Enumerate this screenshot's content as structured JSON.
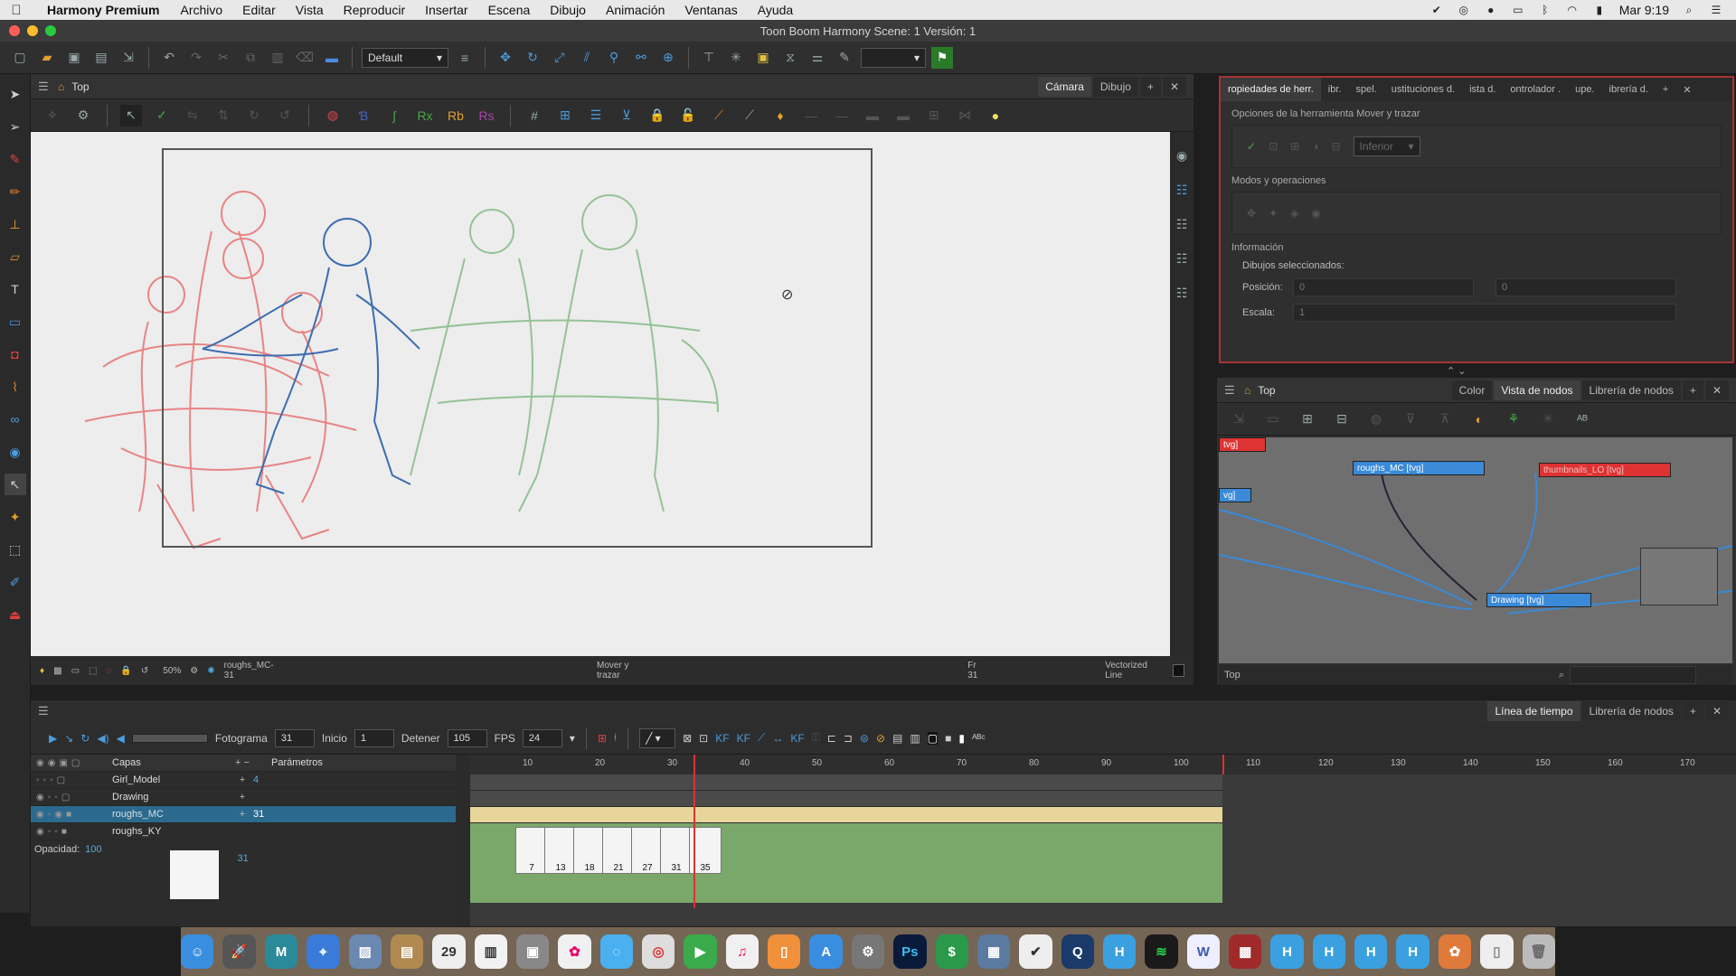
{
  "menubar": {
    "app_name": "Harmony Premium",
    "menus": [
      "Archivo",
      "Editar",
      "Vista",
      "Reproducir",
      "Insertar",
      "Escena",
      "Dibujo",
      "Animación",
      "Ventanas",
      "Ayuda"
    ],
    "clock": "Mar 9:19"
  },
  "window": {
    "title": "Toon Boom Harmony Scene: 1 Versión: 1"
  },
  "toolbar": {
    "workspace": "Default"
  },
  "camera": {
    "title": "Top",
    "tabs": [
      "Cámara",
      "Dibujo"
    ],
    "zoom": "50%",
    "drawing_name": "roughs_MC-31",
    "tool_name": "Mover y trazar",
    "frame": "Fr 31",
    "line_type": "Vectorized Line"
  },
  "tool_properties": {
    "tabs": [
      "ropiedades de herr.",
      "ibr.",
      "spel.",
      "ustituciones d.",
      "ista d.",
      "ontrolador .",
      "upe.",
      "ibrería d."
    ],
    "options_title": "Opciones de la herramienta Mover y trazar",
    "dropdown": "Inferior",
    "modes_title": "Modos y operaciones",
    "info_title": "Información",
    "selected_label": "Dibujos seleccionados:",
    "position_label": "Posición:",
    "position_x": "0",
    "position_y": "0",
    "scale_label": "Escala:",
    "scale_value": "1"
  },
  "node_view": {
    "title": "Top",
    "tabs": [
      "Color",
      "Vista de nodos",
      "Librería de nodos"
    ],
    "nodes": {
      "tl": "tvg]",
      "mc": "roughs_MC [tvg]",
      "lo": "thumbnails_LO [tvg]",
      "left": "vg]",
      "drawing": "Drawing [tvg]"
    },
    "footer": "Top"
  },
  "timeline": {
    "tabs": [
      "Línea de tiempo",
      "Librería de nodos"
    ],
    "frame_label": "Fotograma",
    "frame_value": "31",
    "start_label": "Inicio",
    "start_value": "1",
    "stop_label": "Detener",
    "stop_value": "105",
    "fps_label": "FPS",
    "fps_value": "24",
    "layers_header": "Capas",
    "params_header": "Parámetros",
    "layers": [
      {
        "name": "Girl_Model",
        "param": "4"
      },
      {
        "name": "Drawing",
        "param": ""
      },
      {
        "name": "roughs_MC",
        "param": "31"
      },
      {
        "name": "roughs_KY",
        "param": ""
      }
    ],
    "opacity_label": "Opacidad:",
    "opacity_value": "100",
    "opacity_param": "31",
    "ruler": [
      "10",
      "20",
      "30",
      "40",
      "50",
      "60",
      "70",
      "80",
      "90",
      "100",
      "110",
      "120",
      "130",
      "140",
      "150",
      "160",
      "170"
    ],
    "thumb_frames": [
      "7",
      "13",
      "18",
      "21",
      "27",
      "31",
      "35"
    ]
  },
  "colors": {
    "accent_blue": "#2b6a8e",
    "red_border": "#aa3333",
    "playhead": "#e03030"
  }
}
